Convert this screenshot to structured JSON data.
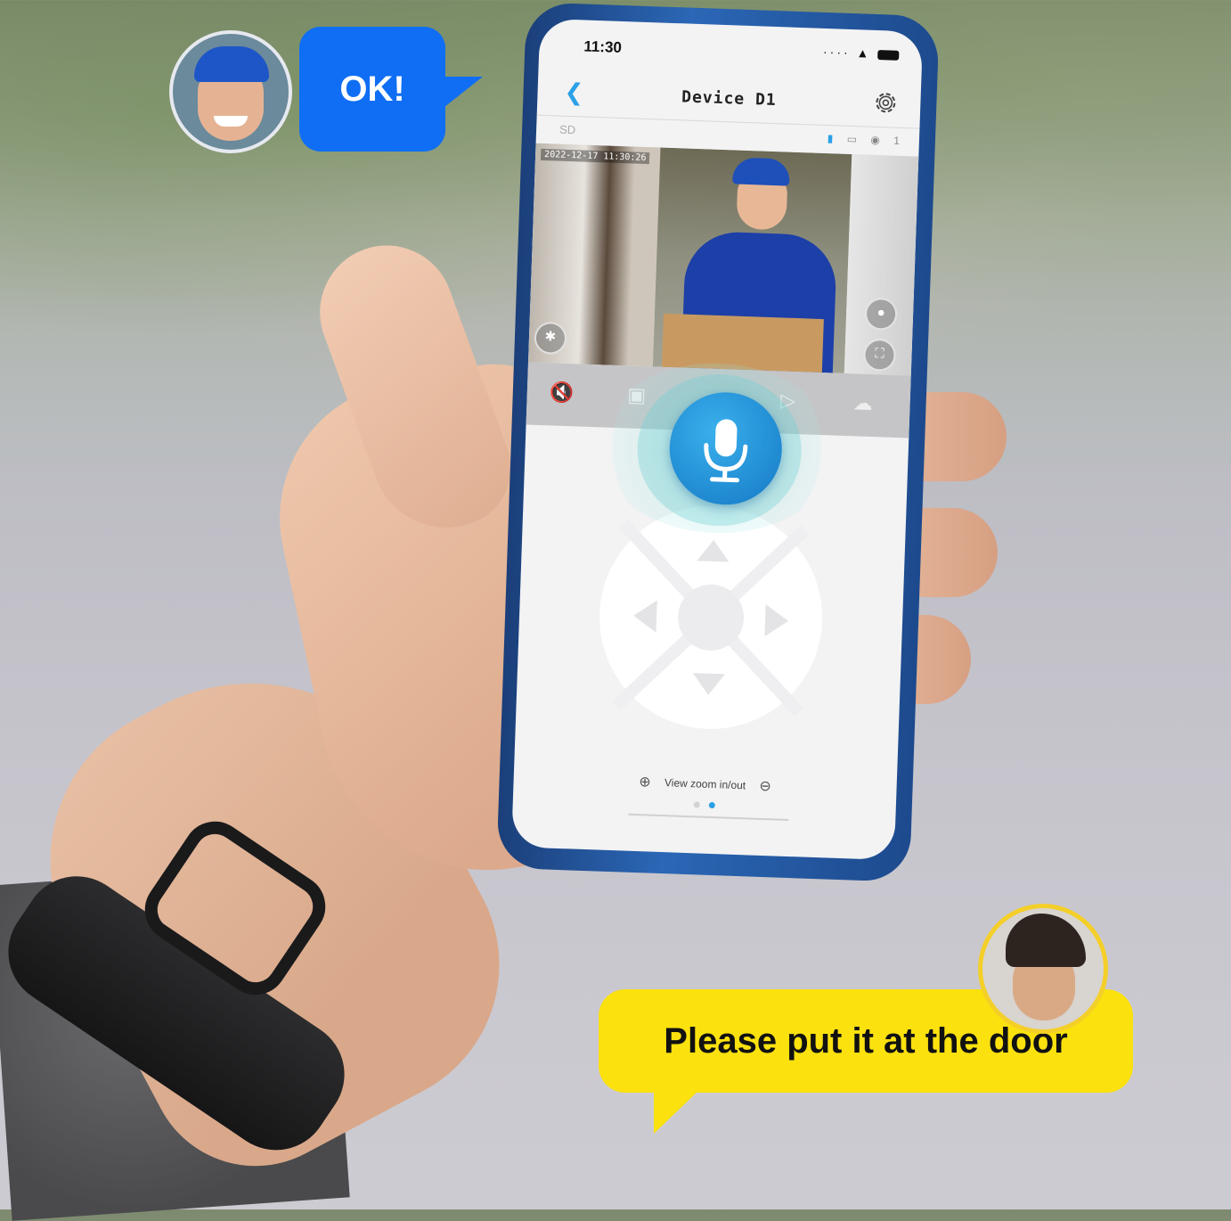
{
  "phone": {
    "status_time": "11:30",
    "nav_title": "Device D1",
    "storage_label": "SD",
    "viewer_count": "1",
    "video_timestamp": "2022-12-17 11:30:26"
  },
  "controls": {
    "zoom_label": "View zoom in/out",
    "page_indicator": {
      "total": 2,
      "active": 2
    }
  },
  "bubbles": {
    "courier_reply": "OK!",
    "owner_message": "Please put it at the door"
  },
  "colors": {
    "accent": "#2aa0e6",
    "mic_button": "#1478c5",
    "bubble_blue": "#0f6ef3",
    "bubble_yellow": "#fbe10e"
  },
  "icons": {
    "back": "chevron-left-icon",
    "settings": "gear-icon",
    "speaker": "speaker-mute-icon",
    "snapshot": "camera-icon",
    "record": "video-record-icon",
    "cloud": "cloud-icon",
    "talk": "microphone-icon",
    "light": "lightbulb-icon",
    "fullscreen": "fullscreen-icon",
    "ptz": "ptz-icon",
    "zoom_in": "zoom-in-icon",
    "zoom_out": "zoom-out-icon"
  }
}
